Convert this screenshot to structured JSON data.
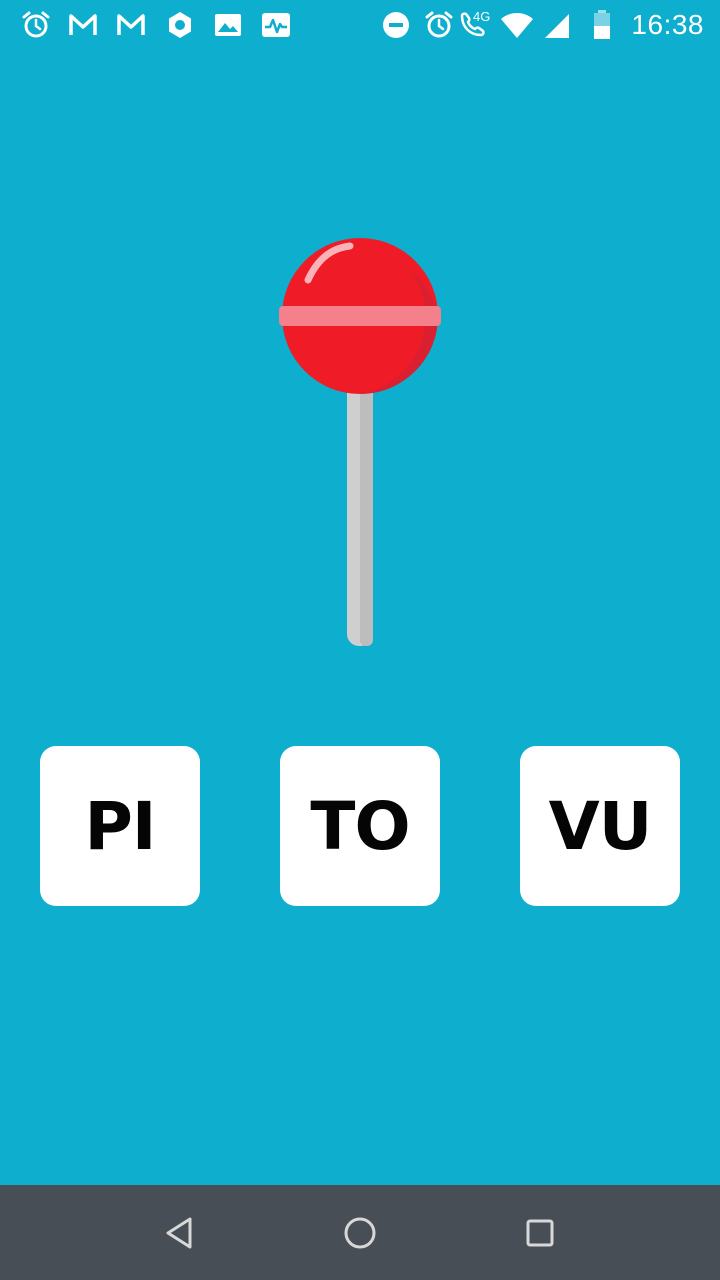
{
  "status_bar": {
    "time": "16:38",
    "network": "4G",
    "left_icons": [
      "alarm-icon",
      "gmail-icon",
      "gmail-icon",
      "settings-icon",
      "gallery-icon",
      "activity-icon"
    ],
    "right_icons": [
      "do-not-disturb-icon",
      "alarm-icon",
      "wifi-calling-icon",
      "wifi-icon",
      "signal-icon",
      "battery-icon"
    ]
  },
  "illustration": {
    "subject": "lollipop-icon",
    "colors": {
      "candy": "#ef1c27",
      "candy_shadow": "#d91f30",
      "band": "#f4808b",
      "stick": "#cfcfcf"
    }
  },
  "answers": [
    {
      "label": "PI"
    },
    {
      "label": "TO"
    },
    {
      "label": "VU"
    }
  ],
  "nav_bar": {
    "buttons": [
      "back-icon",
      "home-icon",
      "recents-icon"
    ]
  },
  "colors": {
    "background": "#0eaece",
    "nav_bar": "#474e55",
    "button_bg": "#ffffff"
  }
}
